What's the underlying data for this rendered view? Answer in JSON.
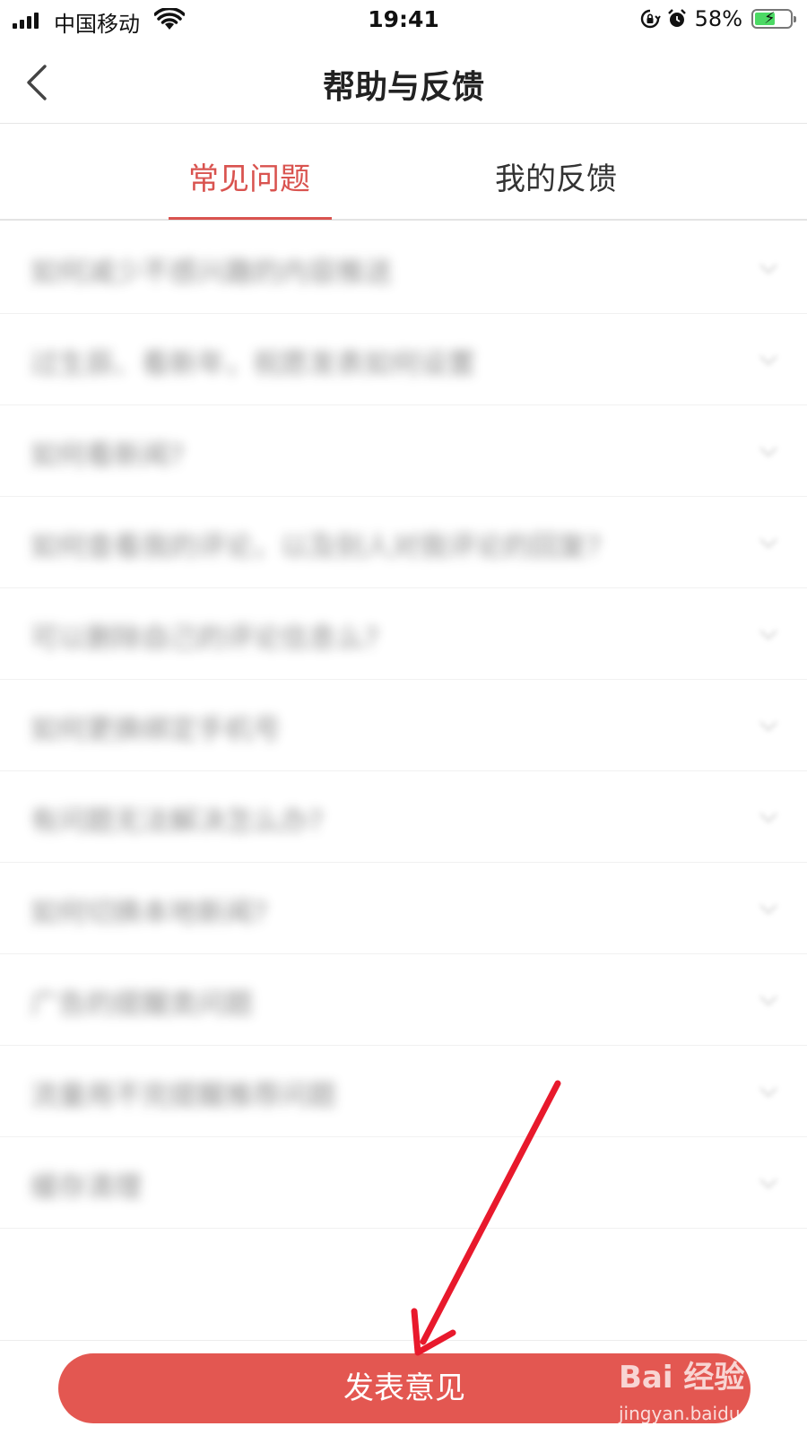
{
  "status_bar": {
    "carrier": "中国移动",
    "time": "19:41",
    "battery_percent": "58%",
    "battery_level": 0.58,
    "icons": [
      "signal-icon",
      "wifi-icon",
      "rotation-lock-icon",
      "alarm-icon",
      "battery-charging-icon"
    ]
  },
  "nav": {
    "title": "帮助与反馈",
    "back_icon": "chevron-left-icon"
  },
  "tabs": [
    {
      "label": "常见问题",
      "active": true
    },
    {
      "label": "我的反馈",
      "active": false
    }
  ],
  "colors": {
    "accent": "#d9534f",
    "button": "#e35751",
    "annotation_arrow": "#e8192c"
  },
  "faq": {
    "note": "question texts are blurred in the screenshot",
    "items": [
      {
        "question": "如何减少不感兴趣的内容推送"
      },
      {
        "question": "过生辰、看新年，祝愿发表如何设置"
      },
      {
        "question": "如何看新闻?"
      },
      {
        "question": "如何查看我的评论，以及别人对我评论的回复?"
      },
      {
        "question": "可以删除自己的评论信息么?"
      },
      {
        "question": "如何更换绑定手机号"
      },
      {
        "question": "有问题无法解决怎么办?"
      },
      {
        "question": "如何切换本地新闻?"
      },
      {
        "question": "广告的提醒类问题"
      },
      {
        "question": "流量用不完提醒推荐问题"
      },
      {
        "question": "缓存清理"
      }
    ]
  },
  "bottom": {
    "submit_label": "发表意见"
  },
  "watermark": {
    "logo": "Bai 经验",
    "url": "jingyan.baidu.com"
  }
}
